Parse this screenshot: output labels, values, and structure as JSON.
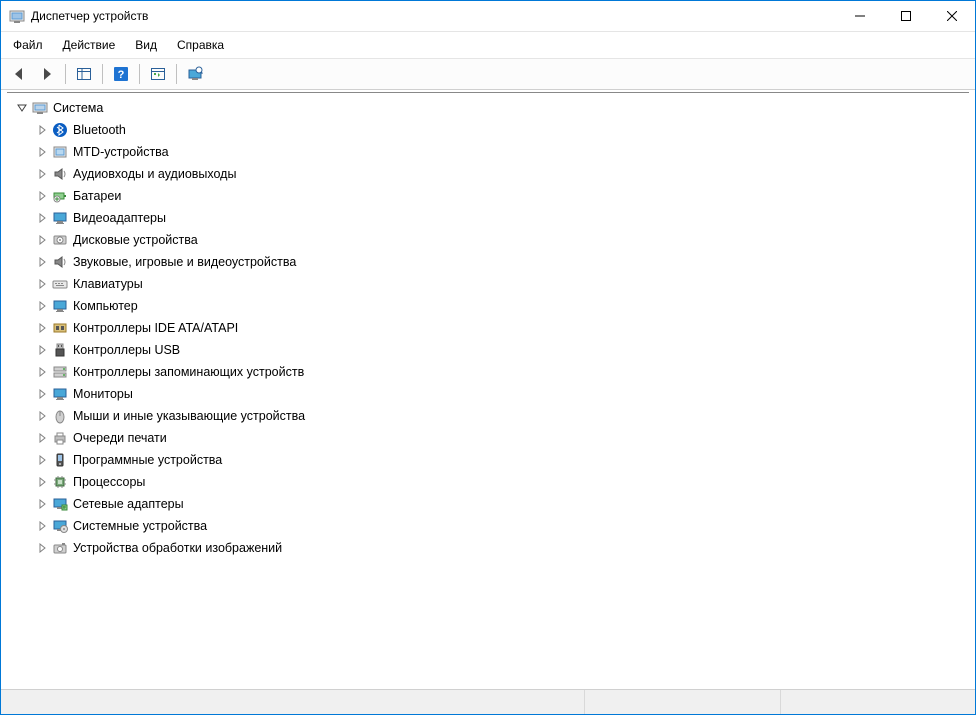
{
  "window": {
    "title": "Диспетчер устройств"
  },
  "menu": {
    "file": "Файл",
    "action": "Действие",
    "view": "Вид",
    "help": "Справка"
  },
  "tree": {
    "root": {
      "label": "Система",
      "expanded": true
    },
    "children": [
      {
        "label": "Bluetooth",
        "icon": "bluetooth"
      },
      {
        "label": "MTD-устройства",
        "icon": "mtd"
      },
      {
        "label": "Аудиовходы и аудиовыходы",
        "icon": "audio"
      },
      {
        "label": "Батареи",
        "icon": "battery"
      },
      {
        "label": "Видеоадаптеры",
        "icon": "display-adapter"
      },
      {
        "label": "Дисковые устройства",
        "icon": "disk"
      },
      {
        "label": "Звуковые, игровые и видеоустройства",
        "icon": "sound"
      },
      {
        "label": "Клавиатуры",
        "icon": "keyboard"
      },
      {
        "label": "Компьютер",
        "icon": "computer"
      },
      {
        "label": "Контроллеры IDE ATA/ATAPI",
        "icon": "ide"
      },
      {
        "label": "Контроллеры USB",
        "icon": "usb"
      },
      {
        "label": "Контроллеры запоминающих устройств",
        "icon": "storage-ctrl"
      },
      {
        "label": "Мониторы",
        "icon": "monitor"
      },
      {
        "label": "Мыши и иные указывающие устройства",
        "icon": "mouse"
      },
      {
        "label": "Очереди печати",
        "icon": "printer"
      },
      {
        "label": "Программные устройства",
        "icon": "software-dev"
      },
      {
        "label": "Процессоры",
        "icon": "cpu"
      },
      {
        "label": "Сетевые адаптеры",
        "icon": "network"
      },
      {
        "label": "Системные устройства",
        "icon": "system-dev"
      },
      {
        "label": "Устройства обработки изображений",
        "icon": "imaging"
      }
    ]
  }
}
